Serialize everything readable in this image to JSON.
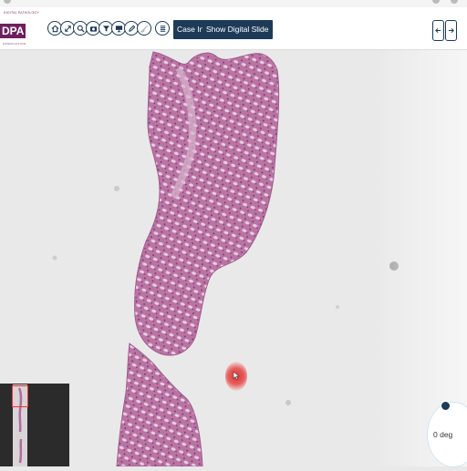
{
  "header": {
    "logo_text": "DPA",
    "logo_small": "DIGITAL PATHOLOGY",
    "logo_sub": "ASSOCIATION",
    "tools": [
      {
        "name": "home-icon"
      },
      {
        "name": "expand-icon"
      },
      {
        "name": "zoom-icon"
      },
      {
        "name": "camera-icon"
      },
      {
        "name": "filter-icon"
      },
      {
        "name": "monitor-icon"
      },
      {
        "name": "pen-icon"
      },
      {
        "name": "brush-icon"
      },
      {
        "name": "list-icon"
      }
    ],
    "case_info_label": "Case Info",
    "show_digital_slide_label": "Show Digital Slide",
    "prev_icon": "arrow-left-icon",
    "next_icon": "arrow-right-icon"
  },
  "viewer": {
    "rotation_label": "0 deg",
    "minimap_label": "slide-overview"
  },
  "colors": {
    "toolbar_button": "#1d3b58",
    "brand": "#6e1f5f",
    "tissue": "#b6719f",
    "background": "#e9e9e9"
  }
}
